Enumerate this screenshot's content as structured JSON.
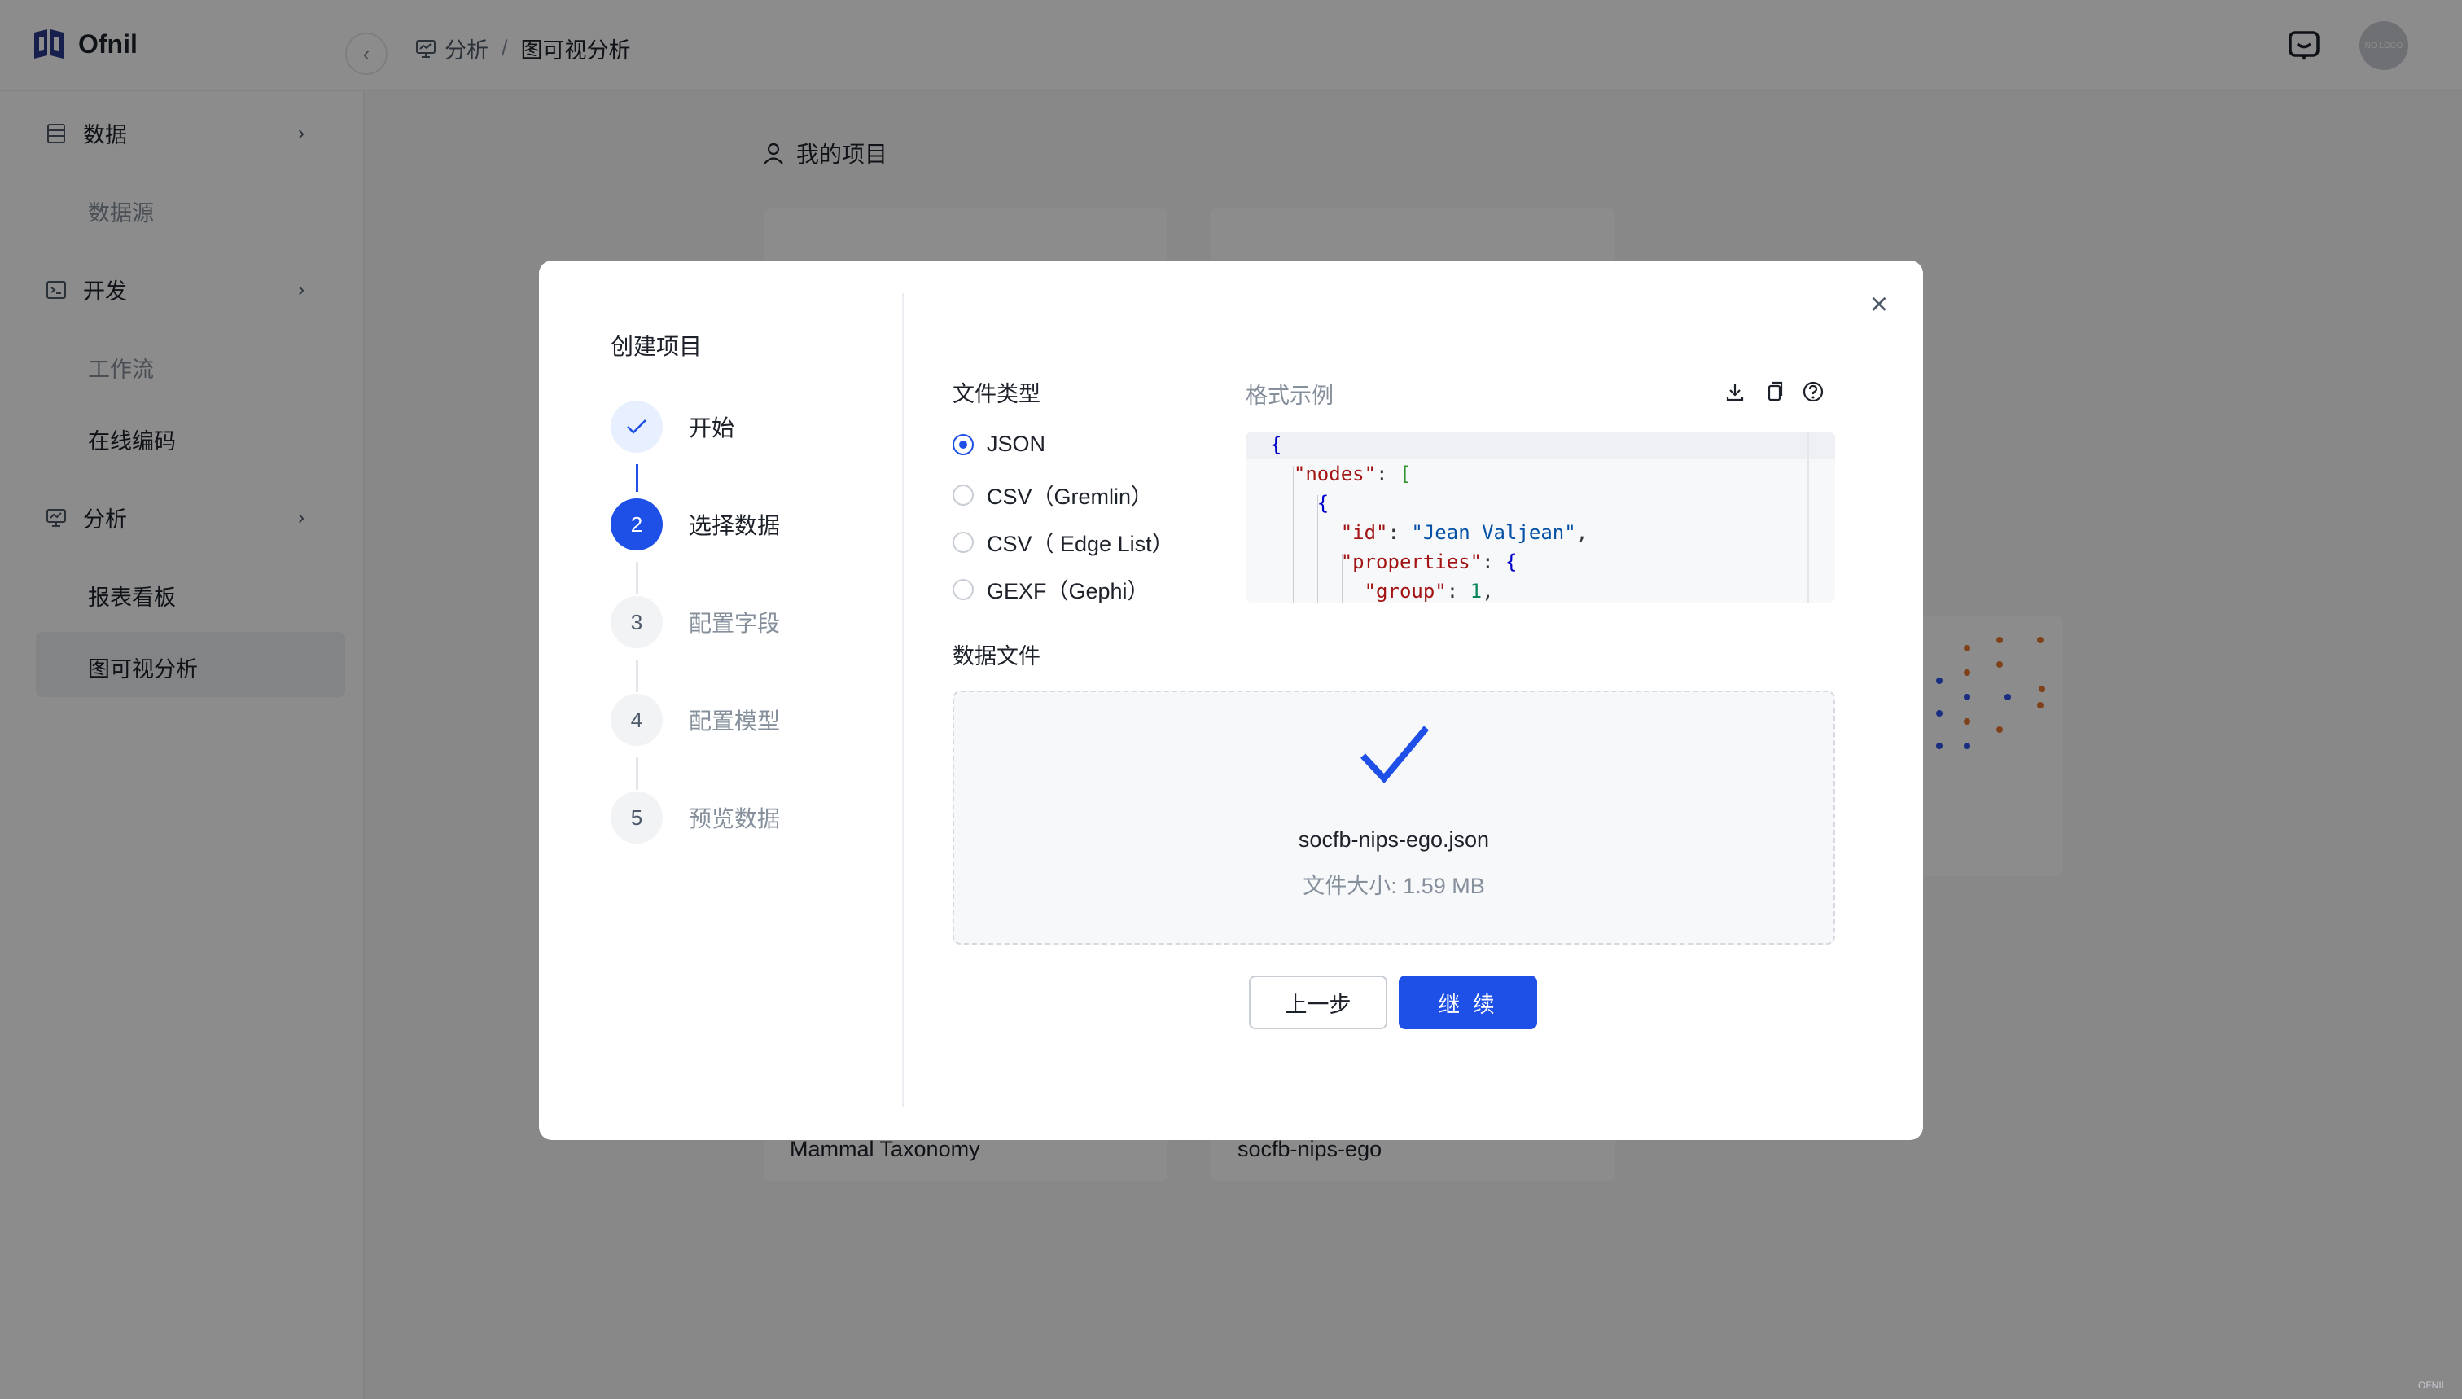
{
  "app": {
    "logo_text": "Ofnil",
    "avatar_text": "NO LOGO",
    "footer_mark": "OFNIL"
  },
  "breadcrumb": {
    "parent": "分析",
    "separator": "/",
    "current": "图可视分析"
  },
  "sidebar": {
    "groups": [
      {
        "label": "数据",
        "icon": "database-icon"
      },
      {
        "label": "开发",
        "icon": "terminal-icon"
      },
      {
        "label": "分析",
        "icon": "analysis-icon"
      }
    ],
    "items": {
      "datasource": "数据源",
      "workflow": "工作流",
      "online_coding": "在线编码",
      "dashboard": "报表看板",
      "graph_analysis": "图可视分析"
    }
  },
  "main": {
    "section_title": "我的项目",
    "cards": [
      {
        "title": "Mammal Taxonomy"
      },
      {
        "title": "socfb-nips-ego"
      }
    ]
  },
  "modal": {
    "title": "创建项目",
    "steps": [
      {
        "number": "1",
        "label": "开始",
        "state": "done"
      },
      {
        "number": "2",
        "label": "选择数据",
        "state": "active"
      },
      {
        "number": "3",
        "label": "配置字段",
        "state": "pending"
      },
      {
        "number": "4",
        "label": "配置模型",
        "state": "pending"
      },
      {
        "number": "5",
        "label": "预览数据",
        "state": "pending"
      }
    ],
    "file_type": {
      "title": "文件类型",
      "options": [
        "JSON",
        "CSV（Gremlin）",
        "CSV（ Edge List）",
        "GEXF（Gephi）"
      ],
      "selected": "JSON"
    },
    "format_example": {
      "title": "格式示例",
      "tools": [
        "download-icon",
        "copy-icon",
        "help-icon"
      ]
    },
    "data_file": {
      "title": "数据文件",
      "file_name": "socfb-nips-ego.json",
      "file_size": "文件大小: 1.59 MB"
    },
    "buttons": {
      "prev": "上一步",
      "next": "继 续"
    }
  },
  "colors": {
    "primary": "#1e4fe6",
    "overlay": "rgba(0,0,0,0.45)"
  }
}
